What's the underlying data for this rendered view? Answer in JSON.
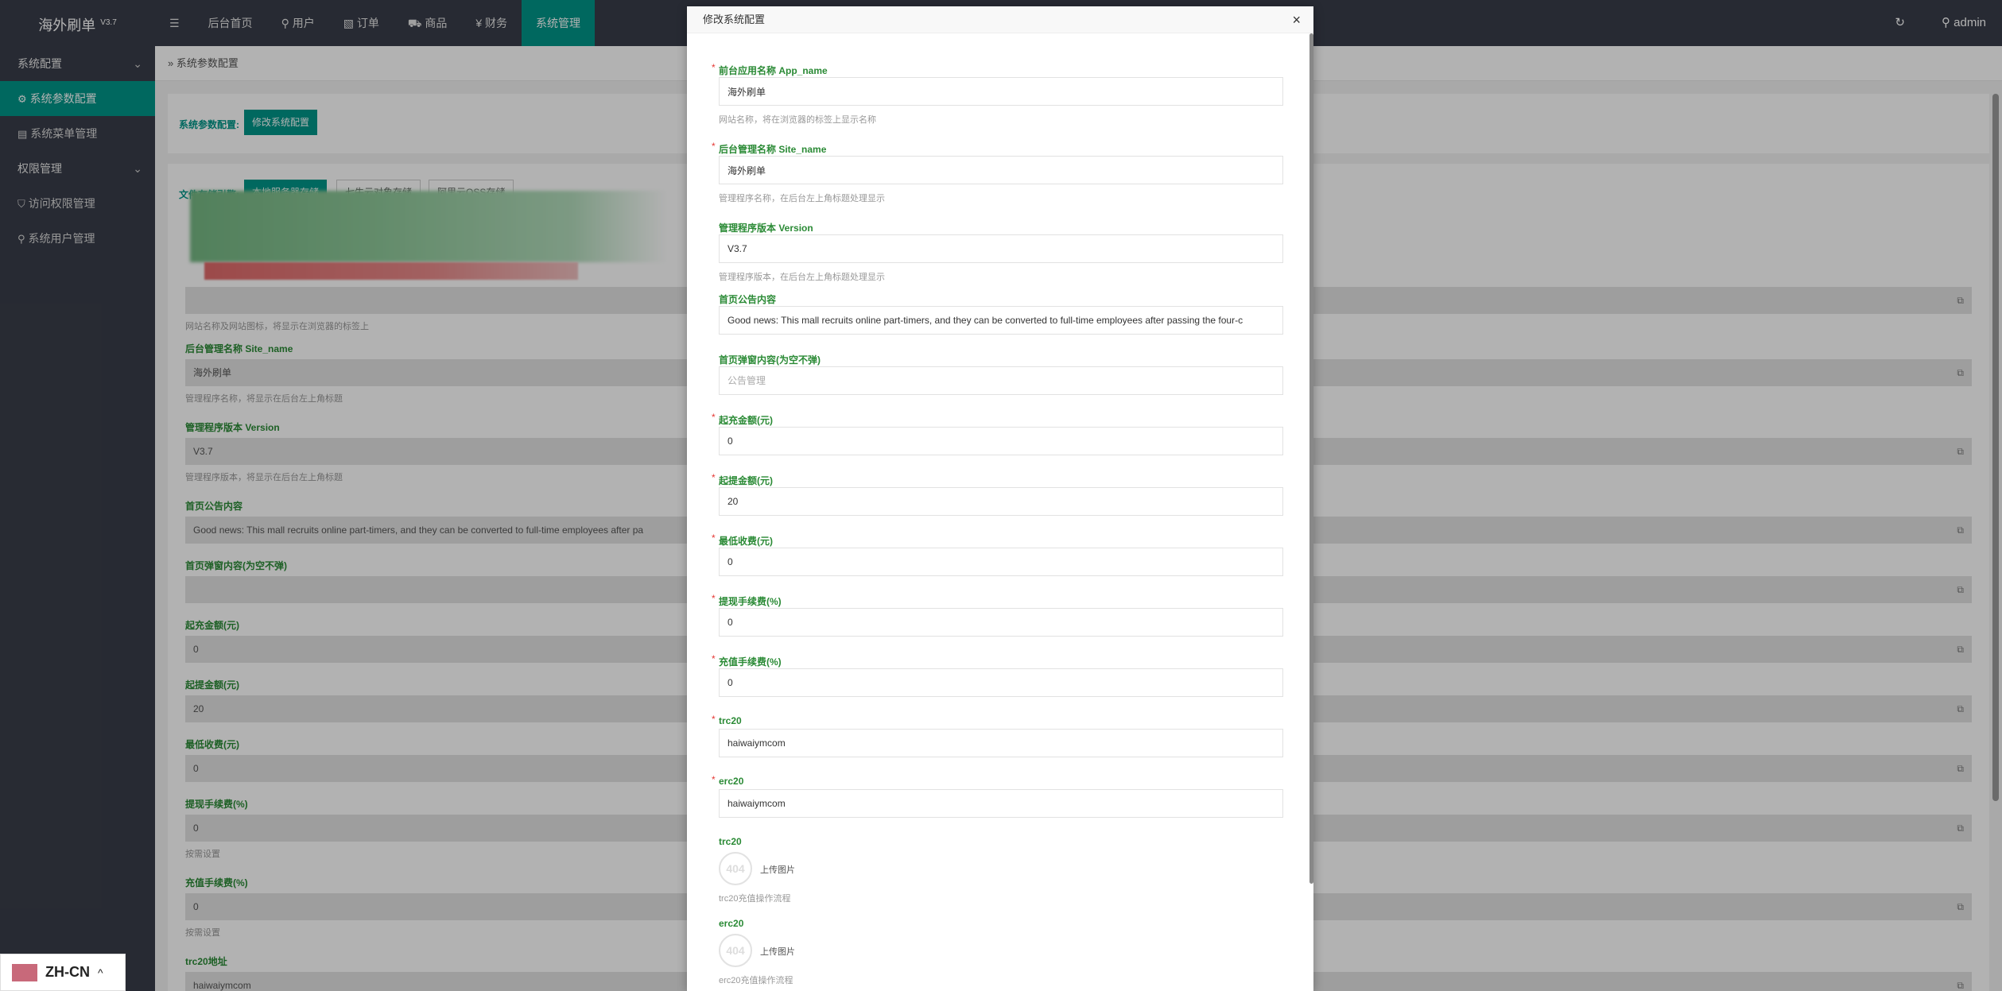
{
  "app": {
    "title": "海外刷单",
    "version": "V3.7"
  },
  "sidebar": {
    "groups": [
      {
        "label": "系统配置",
        "items": [
          {
            "label": "系统参数配置",
            "icon": "gear-icon",
            "active": true
          },
          {
            "label": "系统菜单管理",
            "icon": "calendar-icon",
            "active": false
          }
        ]
      },
      {
        "label": "权限管理",
        "items": [
          {
            "label": "访问权限管理",
            "icon": "shield-icon",
            "active": false
          },
          {
            "label": "系统用户管理",
            "icon": "user-icon",
            "active": false
          }
        ]
      }
    ]
  },
  "topnav": {
    "menu_icon": "☰",
    "items": [
      {
        "label": "后台首页",
        "icon": ""
      },
      {
        "label": "用户",
        "icon": "user-icon"
      },
      {
        "label": "订单",
        "icon": "doc-icon"
      },
      {
        "label": "商品",
        "icon": "cart-icon"
      },
      {
        "label": "财务",
        "icon": "yen-icon"
      },
      {
        "label": "系统管理",
        "icon": "",
        "active": true
      }
    ],
    "user": "admin"
  },
  "page": {
    "breadcrumb": "系统参数配置",
    "config_label": "系统参数配置:",
    "edit_button": "修改系统配置",
    "storage_label": "文件存储引擎:",
    "storage_options": [
      "本地服务器存储",
      "七牛云对象存储",
      "阿里云OSS存储"
    ],
    "fields": [
      {
        "label": "后台管理名称 Site_name",
        "value": "海外刷单",
        "hint": "管理程序名称，将显示在后台左上角标题"
      },
      {
        "label": "管理程序版本 Version",
        "value": "V3.7",
        "hint": "管理程序版本，将显示在后台左上角标题"
      },
      {
        "label": "首页公告内容",
        "value": "Good news: This mall recruits online part-timers, and they can be converted to full-time employees after pa",
        "hint": ""
      },
      {
        "label": "首页弹窗内容(为空不弹)",
        "value": "",
        "hint": ""
      },
      {
        "label": "起充金额(元)",
        "value": "0",
        "hint": ""
      },
      {
        "label": "起提金额(元)",
        "value": "20",
        "hint": ""
      },
      {
        "label": "最低收费(元)",
        "value": "0",
        "hint": ""
      },
      {
        "label": "提现手续费(%)",
        "value": "0",
        "hint": "按需设置"
      },
      {
        "label": "充值手续费(%)",
        "value": "0",
        "hint": "按需设置"
      },
      {
        "label": "trc20地址",
        "value": "haiwaiymcom",
        "hint": ""
      }
    ],
    "partial_hint": "网站名称及网站图标，将显示在浏览器的标签上"
  },
  "modal": {
    "title": "修改系统配置",
    "close": "×",
    "fields": [
      {
        "label": "前台应用名称 App_name",
        "required": true,
        "value": "海外刷单",
        "placeholder": "",
        "hint": "网站名称，将在浏览器的标签上显示名称"
      },
      {
        "label": "后台管理名称 Site_name",
        "required": true,
        "value": "海外刷单",
        "placeholder": "",
        "hint": "管理程序名称，在后台左上角标题处理显示"
      },
      {
        "label": "管理程序版本 Version",
        "required": false,
        "value": "V3.7",
        "placeholder": "",
        "hint": "管理程序版本，在后台左上角标题处理显示"
      },
      {
        "label": "首页公告内容",
        "required": false,
        "value": "Good news: This mall recruits online part-timers, and they can be converted to full-time employees after passing the four-c",
        "placeholder": "",
        "hint": ""
      },
      {
        "label": "首页弹窗内容(为空不弹)",
        "required": false,
        "value": "",
        "placeholder": "公告管理",
        "hint": ""
      },
      {
        "label": "起充金额(元)",
        "required": true,
        "value": "0",
        "placeholder": "",
        "hint": ""
      },
      {
        "label": "起提金额(元)",
        "required": true,
        "value": "20",
        "placeholder": "",
        "hint": ""
      },
      {
        "label": "最低收费(元)",
        "required": true,
        "value": "0",
        "placeholder": "",
        "hint": ""
      },
      {
        "label": "提现手续费(%)",
        "required": true,
        "value": "0",
        "placeholder": "",
        "hint": ""
      },
      {
        "label": "充值手续费(%)",
        "required": true,
        "value": "0",
        "placeholder": "",
        "hint": ""
      },
      {
        "label": "trc20",
        "required": true,
        "value": "haiwaiymcom",
        "placeholder": "",
        "hint": ""
      },
      {
        "label": "erc20",
        "required": true,
        "value": "haiwaiymcom",
        "placeholder": "",
        "hint": ""
      }
    ],
    "uploads": [
      {
        "label": "trc20",
        "placeholder_text": "404",
        "button": "上传图片",
        "hint": "trc20充值操作流程"
      },
      {
        "label": "erc20",
        "placeholder_text": "404",
        "button": "上传图片",
        "hint": "erc20充值操作流程"
      }
    ]
  },
  "language": {
    "code": "ZH-CN",
    "caret": "^"
  },
  "colors": {
    "accent": "#009688",
    "sidebar": "#393d49",
    "label_green": "#2a8a35",
    "required": "#e53935"
  }
}
